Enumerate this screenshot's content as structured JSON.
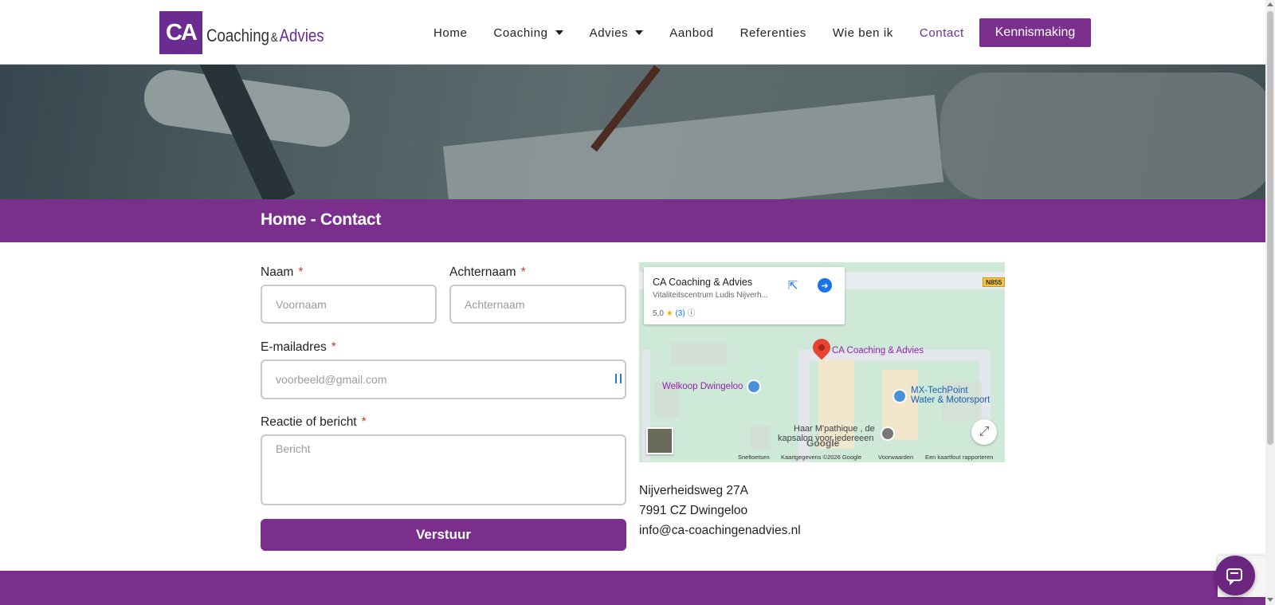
{
  "logo": {
    "mark": "CA",
    "word1": "Coaching",
    "amp": "&",
    "word2": "Advies"
  },
  "nav": {
    "items": [
      {
        "label": "Home",
        "dropdown": false,
        "active": false
      },
      {
        "label": "Coaching",
        "dropdown": true,
        "active": false
      },
      {
        "label": "Advies",
        "dropdown": true,
        "active": false
      },
      {
        "label": "Aanbod",
        "dropdown": false,
        "active": false
      },
      {
        "label": "Referenties",
        "dropdown": false,
        "active": false
      },
      {
        "label": "Wie ben ik",
        "dropdown": false,
        "active": false
      },
      {
        "label": "Contact",
        "dropdown": false,
        "active": true
      }
    ],
    "cta": "Kennismaking"
  },
  "band": {
    "title": "Home - Contact"
  },
  "form": {
    "first_name": {
      "label": "Naam",
      "required": "*",
      "placeholder": "Voornaam"
    },
    "last_name": {
      "label": "Achternaam",
      "required": "*",
      "placeholder": "Achternaam"
    },
    "email": {
      "label": "E-mailadres",
      "required": "*",
      "placeholder": "voorbeeld@gmail.com"
    },
    "message": {
      "label": "Reactie of bericht",
      "required": "*",
      "placeholder": "Bericht"
    },
    "submit": "Verstuur"
  },
  "map": {
    "card_title": "CA Coaching & Advies",
    "card_subtitle": "Vitaliteitscentrum Ludis Nijverh...",
    "rating": "5,0",
    "reviews": "(3)",
    "road_label": "N855",
    "pin_label": "CA Coaching & Advies",
    "poi1": "Welkoop Dwingeloo",
    "poi2_line1": "MX-TechPoint",
    "poi2_line2": "Water & Motorsport",
    "poi3_line1": "Haar M'pathique , de",
    "poi3_line2": "kapsalon voor iedereeen",
    "google": "Google",
    "footer": [
      "Sneltoetsen",
      "Kaartgegevens ©2026 Google",
      "Voorwaarden",
      "Een kaartfout rapporteren"
    ]
  },
  "address": {
    "street": "Nijverheidsweg 27A",
    "city": "7991 CZ Dwingeloo",
    "email": "info@ca-coachingenadvies.nl"
  },
  "colors": {
    "brand": "#7a2f8c",
    "text": "#222222"
  }
}
